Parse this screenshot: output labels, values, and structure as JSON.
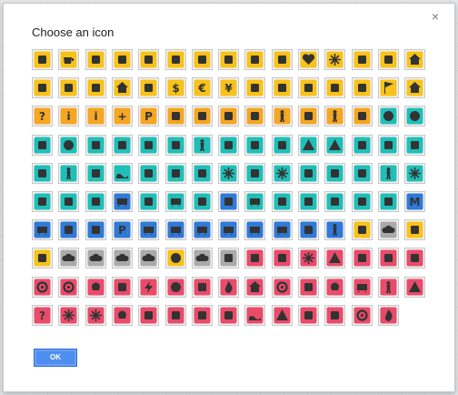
{
  "dialog": {
    "title": "Choose an icon",
    "close_glyph": "×",
    "ok_label": "OK"
  },
  "colors": {
    "yellow": "#f7c21a",
    "orange": "#f5a623",
    "teal": "#1fbfb8",
    "blue": "#2f7ad8",
    "pink": "#e94b6a",
    "glyph": "#333333",
    "tile_bg": "#f1f1f1",
    "tile_border": "#c8c8c8",
    "ok_bg": "#4d8ef0"
  },
  "icons": [
    {
      "name": "restaurant",
      "color": "#f7c21a",
      "glyph": "fork-knife"
    },
    {
      "name": "cafe",
      "color": "#f7c21a",
      "glyph": "cup"
    },
    {
      "name": "bar",
      "color": "#f7c21a",
      "glyph": "martini"
    },
    {
      "name": "fast-food",
      "color": "#f7c21a",
      "glyph": "burger"
    },
    {
      "name": "ice-cream",
      "color": "#f7c21a",
      "glyph": "bowl"
    },
    {
      "name": "shopping-bag",
      "color": "#f7c21a",
      "glyph": "bag"
    },
    {
      "name": "cinema",
      "color": "#f7c21a",
      "glyph": "film"
    },
    {
      "name": "thumbs-up",
      "color": "#f7c21a",
      "glyph": "thumb"
    },
    {
      "name": "shopping-cart",
      "color": "#f7c21a",
      "glyph": "cart"
    },
    {
      "name": "theater",
      "color": "#f7c21a",
      "glyph": "mask"
    },
    {
      "name": "heart",
      "color": "#f7c21a",
      "glyph": "heart"
    },
    {
      "name": "flower",
      "color": "#f7c21a",
      "glyph": "flower"
    },
    {
      "name": "gift",
      "color": "#f7c21a",
      "glyph": "gift"
    },
    {
      "name": "music",
      "color": "#f7c21a",
      "glyph": "note"
    },
    {
      "name": "home",
      "color": "#f7c21a",
      "glyph": "house"
    },
    {
      "name": "tv",
      "color": "#f7c21a",
      "glyph": "tv"
    },
    {
      "name": "wrench",
      "color": "#f7c21a",
      "glyph": "wrench"
    },
    {
      "name": "gas-station",
      "color": "#f7c21a",
      "glyph": "pump"
    },
    {
      "name": "hotel",
      "color": "#f7c21a",
      "glyph": "house"
    },
    {
      "name": "scissors",
      "color": "#f7c21a",
      "glyph": "scissors"
    },
    {
      "name": "dollar",
      "color": "#f7c21a",
      "glyph": "$"
    },
    {
      "name": "euro",
      "color": "#f7c21a",
      "glyph": "€"
    },
    {
      "name": "yen",
      "color": "#f7c21a",
      "glyph": "¥"
    },
    {
      "name": "bed",
      "color": "#f7c21a",
      "glyph": "bed"
    },
    {
      "name": "camera",
      "color": "#f7c21a",
      "glyph": "camera"
    },
    {
      "name": "mail",
      "color": "#f7c21a",
      "glyph": "envelope"
    },
    {
      "name": "video",
      "color": "#f7c21a",
      "glyph": "video"
    },
    {
      "name": "pet",
      "color": "#f7c21a",
      "glyph": "dog"
    },
    {
      "name": "flag",
      "color": "#f7c21a",
      "glyph": "flag"
    },
    {
      "name": "house-outline",
      "color": "#f7c21a",
      "glyph": "house"
    },
    {
      "name": "help",
      "color": "#f5a623",
      "glyph": "?"
    },
    {
      "name": "info-italic",
      "color": "#f5a623",
      "glyph": "i"
    },
    {
      "name": "info",
      "color": "#f5a623",
      "glyph": "i"
    },
    {
      "name": "hospital",
      "color": "#f5a623",
      "glyph": "+"
    },
    {
      "name": "parking",
      "color": "#f5a623",
      "glyph": "P"
    },
    {
      "name": "phone",
      "color": "#f5a623",
      "glyph": "phone"
    },
    {
      "name": "star-person",
      "color": "#f5a623",
      "glyph": "star"
    },
    {
      "name": "baby",
      "color": "#f5a623",
      "glyph": "baby"
    },
    {
      "name": "stroller",
      "color": "#f5a623",
      "glyph": "stroller"
    },
    {
      "name": "man",
      "color": "#f5a623",
      "glyph": "person"
    },
    {
      "name": "restroom",
      "color": "#f5a623",
      "glyph": "people"
    },
    {
      "name": "woman",
      "color": "#f5a623",
      "glyph": "person"
    },
    {
      "name": "wheelchair",
      "color": "#f5a623",
      "glyph": "wheel"
    },
    {
      "name": "tennis",
      "color": "#1fbfb8",
      "glyph": "ball"
    },
    {
      "name": "basketball",
      "color": "#1fbfb8",
      "glyph": "ball"
    },
    {
      "name": "bird",
      "color": "#1fbfb8",
      "glyph": "bird"
    },
    {
      "name": "bowling",
      "color": "#1fbfb8",
      "glyph": "ball"
    },
    {
      "name": "skiing",
      "color": "#1fbfb8",
      "glyph": "ski"
    },
    {
      "name": "fishing",
      "color": "#1fbfb8",
      "glyph": "hook"
    },
    {
      "name": "fish",
      "color": "#1fbfb8",
      "glyph": "fish"
    },
    {
      "name": "football",
      "color": "#1fbfb8",
      "glyph": "oval"
    },
    {
      "name": "hiking",
      "color": "#1fbfb8",
      "glyph": "walker"
    },
    {
      "name": "martial-arts",
      "color": "#1fbfb8",
      "glyph": "fighter"
    },
    {
      "name": "horse",
      "color": "#1fbfb8",
      "glyph": "horse"
    },
    {
      "name": "snowboard",
      "color": "#1fbfb8",
      "glyph": "ski"
    },
    {
      "name": "mountain",
      "color": "#1fbfb8",
      "glyph": "mountain"
    },
    {
      "name": "tree",
      "color": "#1fbfb8",
      "glyph": "tree"
    },
    {
      "name": "picnic",
      "color": "#1fbfb8",
      "glyph": "table"
    },
    {
      "name": "playground",
      "color": "#1fbfb8",
      "glyph": "arch"
    },
    {
      "name": "racing-flag",
      "color": "#1fbfb8",
      "glyph": "checker"
    },
    {
      "name": "sailing",
      "color": "#1fbfb8",
      "glyph": "boat"
    },
    {
      "name": "running",
      "color": "#1fbfb8",
      "glyph": "runner"
    },
    {
      "name": "swimming",
      "color": "#1fbfb8",
      "glyph": "swim"
    },
    {
      "name": "water",
      "color": "#1fbfb8",
      "glyph": "wave"
    },
    {
      "name": "surfing",
      "color": "#1fbfb8",
      "glyph": "surf"
    },
    {
      "name": "search",
      "color": "#1fbfb8",
      "glyph": "magnifier"
    },
    {
      "name": "binoculars",
      "color": "#1fbfb8",
      "glyph": "binoculars"
    },
    {
      "name": "ferris-wheel",
      "color": "#1fbfb8",
      "glyph": "wheel2"
    },
    {
      "name": "half-sun",
      "color": "#1fbfb8",
      "glyph": "dome"
    },
    {
      "name": "sun-wheel",
      "color": "#1fbfb8",
      "glyph": "wheel2"
    },
    {
      "name": "golf",
      "color": "#1fbfb8",
      "glyph": "golfer"
    },
    {
      "name": "ski-jump",
      "color": "#1fbfb8",
      "glyph": "ski"
    },
    {
      "name": "ski-lift",
      "color": "#1fbfb8",
      "glyph": "ski"
    },
    {
      "name": "skater",
      "color": "#1fbfb8",
      "glyph": "walker"
    },
    {
      "name": "snowflake",
      "color": "#1fbfb8",
      "glyph": "snow"
    },
    {
      "name": "airport",
      "color": "#1fbfb8",
      "glyph": "plane"
    },
    {
      "name": "motorcycle",
      "color": "#1fbfb8",
      "glyph": "moto"
    },
    {
      "name": "ferry",
      "color": "#1fbfb8",
      "glyph": "ship"
    },
    {
      "name": "bus",
      "color": "#2f7ad8",
      "glyph": "bus"
    },
    {
      "name": "cable-car",
      "color": "#1fbfb8",
      "glyph": "cable"
    },
    {
      "name": "train",
      "color": "#1fbfb8",
      "glyph": "train"
    },
    {
      "name": "ship",
      "color": "#1fbfb8",
      "glyph": "ship"
    },
    {
      "name": "station",
      "color": "#2f7ad8",
      "glyph": "station"
    },
    {
      "name": "tram",
      "color": "#1fbfb8",
      "glyph": "train"
    },
    {
      "name": "road",
      "color": "#1fbfb8",
      "glyph": "road"
    },
    {
      "name": "helicopter",
      "color": "#1fbfb8",
      "glyph": "heli"
    },
    {
      "name": "lighthouse",
      "color": "#1fbfb8",
      "glyph": "tower"
    },
    {
      "name": "boat",
      "color": "#1fbfb8",
      "glyph": "ship"
    },
    {
      "name": "anchor",
      "color": "#1fbfb8",
      "glyph": "anchor"
    },
    {
      "name": "metro",
      "color": "#2f7ad8",
      "glyph": "M"
    },
    {
      "name": "bus-front",
      "color": "#2f7ad8",
      "glyph": "bus"
    },
    {
      "name": "motorbike",
      "color": "#2f7ad8",
      "glyph": "moto"
    },
    {
      "name": "bicycle",
      "color": "#2f7ad8",
      "glyph": "moto"
    },
    {
      "name": "parking-blue",
      "color": "#2f7ad8",
      "glyph": "P"
    },
    {
      "name": "tank",
      "color": "#2f7ad8",
      "glyph": "truck"
    },
    {
      "name": "car",
      "color": "#2f7ad8",
      "glyph": "car"
    },
    {
      "name": "rail",
      "color": "#2f7ad8",
      "glyph": "train"
    },
    {
      "name": "monorail",
      "color": "#2f7ad8",
      "glyph": "train"
    },
    {
      "name": "bus-side",
      "color": "#2f7ad8",
      "glyph": "bus"
    },
    {
      "name": "truck",
      "color": "#2f7ad8",
      "glyph": "truck"
    },
    {
      "name": "tunnel",
      "color": "#2f7ad8",
      "glyph": "arch"
    },
    {
      "name": "walking",
      "color": "#2f7ad8",
      "glyph": "walker"
    },
    {
      "name": "partly-cloudy",
      "color": "#f7c21a",
      "glyph": "cloudsun"
    },
    {
      "name": "cloudy",
      "color": "#aaaaaa",
      "glyph": "cloud"
    },
    {
      "name": "sunrise",
      "color": "#f7c21a",
      "glyph": "sunrise"
    },
    {
      "name": "moon",
      "color": "#f7c21a",
      "glyph": "moon"
    },
    {
      "name": "hail",
      "color": "#aaaaaa",
      "glyph": "cloud"
    },
    {
      "name": "rain",
      "color": "#aaaaaa",
      "glyph": "cloud"
    },
    {
      "name": "snow-cloud",
      "color": "#aaaaaa",
      "glyph": "cloud"
    },
    {
      "name": "heavy-rain",
      "color": "#aaaaaa",
      "glyph": "cloud"
    },
    {
      "name": "sunny",
      "color": "#f7c21a",
      "glyph": "sun"
    },
    {
      "name": "storm",
      "color": "#aaaaaa",
      "glyph": "cloud"
    },
    {
      "name": "shark",
      "color": "#aaaaaa",
      "glyph": "fin"
    },
    {
      "name": "blender",
      "color": "#e94b6a",
      "glyph": "mixer"
    },
    {
      "name": "paw",
      "color": "#e94b6a",
      "glyph": "paw"
    },
    {
      "name": "biohazard",
      "color": "#e94b6a",
      "glyph": "bio"
    },
    {
      "name": "warning",
      "color": "#e94b6a",
      "glyph": "triangle"
    },
    {
      "name": "flask",
      "color": "#e94b6a",
      "glyph": "flask"
    },
    {
      "name": "megaphone",
      "color": "#e94b6a",
      "glyph": "megaphone"
    },
    {
      "name": "gun",
      "color": "#e94b6a",
      "glyph": "gun"
    },
    {
      "name": "spiral",
      "color": "#e94b6a",
      "glyph": "spiral"
    },
    {
      "name": "hurricane",
      "color": "#e94b6a",
      "glyph": "spiral"
    },
    {
      "name": "poison",
      "color": "#e94b6a",
      "glyph": "skull"
    },
    {
      "name": "heart-rate",
      "color": "#e94b6a",
      "glyph": "pulse"
    },
    {
      "name": "lightning",
      "color": "#e94b6a",
      "glyph": "bolt"
    },
    {
      "name": "target",
      "color": "#e94b6a",
      "glyph": "target"
    },
    {
      "name": "explosion",
      "color": "#e94b6a",
      "glyph": "burst"
    },
    {
      "name": "fire",
      "color": "#e94b6a",
      "glyph": "flame"
    },
    {
      "name": "flood",
      "color": "#e94b6a",
      "glyph": "house"
    },
    {
      "name": "fan",
      "color": "#e94b6a",
      "glyph": "spiral"
    },
    {
      "name": "bomb",
      "color": "#e94b6a",
      "glyph": "burst"
    },
    {
      "name": "skull-bones",
      "color": "#e94b6a",
      "glyph": "skull"
    },
    {
      "name": "crash",
      "color": "#e94b6a",
      "glyph": "car"
    },
    {
      "name": "injury",
      "color": "#e94b6a",
      "glyph": "walker"
    },
    {
      "name": "alert",
      "color": "#e94b6a",
      "glyph": "triangle"
    },
    {
      "name": "unknown",
      "color": "#e94b6a",
      "glyph": "?"
    },
    {
      "name": "virus",
      "color": "#e94b6a",
      "glyph": "snow"
    },
    {
      "name": "radiation",
      "color": "#e94b6a",
      "glyph": "bio"
    },
    {
      "name": "skull",
      "color": "#e94b6a",
      "glyph": "skull"
    },
    {
      "name": "creature",
      "color": "#e94b6a",
      "glyph": "fighter"
    },
    {
      "name": "thermometer",
      "color": "#e94b6a",
      "glyph": "thermo"
    },
    {
      "name": "tornado",
      "color": "#e94b6a",
      "glyph": "tornado"
    },
    {
      "name": "storm-funnel",
      "color": "#e94b6a",
      "glyph": "tornado"
    },
    {
      "name": "tsunami",
      "color": "#e94b6a",
      "glyph": "wave"
    },
    {
      "name": "volcano",
      "color": "#e94b6a",
      "glyph": "mountain"
    },
    {
      "name": "earthquake",
      "color": "#e94b6a",
      "glyph": "burst"
    },
    {
      "name": "leak",
      "color": "#e94b6a",
      "glyph": "pump"
    },
    {
      "name": "windmill",
      "color": "#e94b6a",
      "glyph": "spiral"
    },
    {
      "name": "wildfire",
      "color": "#e94b6a",
      "glyph": "flame"
    }
  ]
}
